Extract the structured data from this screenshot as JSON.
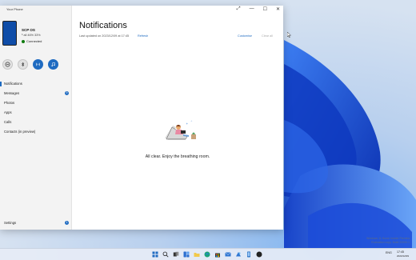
{
  "app": {
    "title": "Your Phone"
  },
  "phone": {
    "name": "SCP OS",
    "status": "ᵇ all 46% 33%",
    "connection": "Connected"
  },
  "quick_actions": [
    {
      "icon": "dnd-icon",
      "active": false
    },
    {
      "icon": "bluetooth-icon",
      "active": false
    },
    {
      "icon": "audio-icon",
      "active": true
    },
    {
      "icon": "music-icon",
      "active": true
    }
  ],
  "nav": {
    "items": [
      {
        "label": "Notifications",
        "selected": true
      },
      {
        "label": "Messages",
        "badge": "9"
      },
      {
        "label": "Photos"
      },
      {
        "label": "Apps"
      },
      {
        "label": "Calls"
      },
      {
        "label": "Contacts (in preview)"
      }
    ],
    "settings": {
      "label": "Settings",
      "badge": "1"
    }
  },
  "main": {
    "title": "Notifications",
    "last_updated": "Last updated on 2023/12/09 at 17:45",
    "refresh_label": "Refresh",
    "customise_label": "Customise",
    "clear_all_label": "Clear all",
    "empty_message": "All clear. Enjoy the breathing room."
  },
  "window_controls": {
    "pin": "⤢",
    "minimize": "—",
    "maximize": "☐",
    "close": "✕"
  },
  "desktop": {
    "watermark_line1": "Windows 11 Home Insider Preview",
    "watermark_line2": "Evaluation copy. Build 22000.1"
  },
  "taskbar": {
    "icons": [
      "start-icon",
      "search-icon",
      "task-view-icon",
      "widgets-icon",
      "file-explorer-icon",
      "edge-icon",
      "store-icon",
      "mail-icon",
      "photos-icon",
      "your-phone-icon",
      "other-app-icon"
    ],
    "tray": {
      "lang": "ENG",
      "time": "17:45",
      "date": "2023/12/09"
    }
  },
  "colors": {
    "accent": "#1f6bc1",
    "connected": "#0f7b0f",
    "wallpaper": "#1a4fd6"
  }
}
